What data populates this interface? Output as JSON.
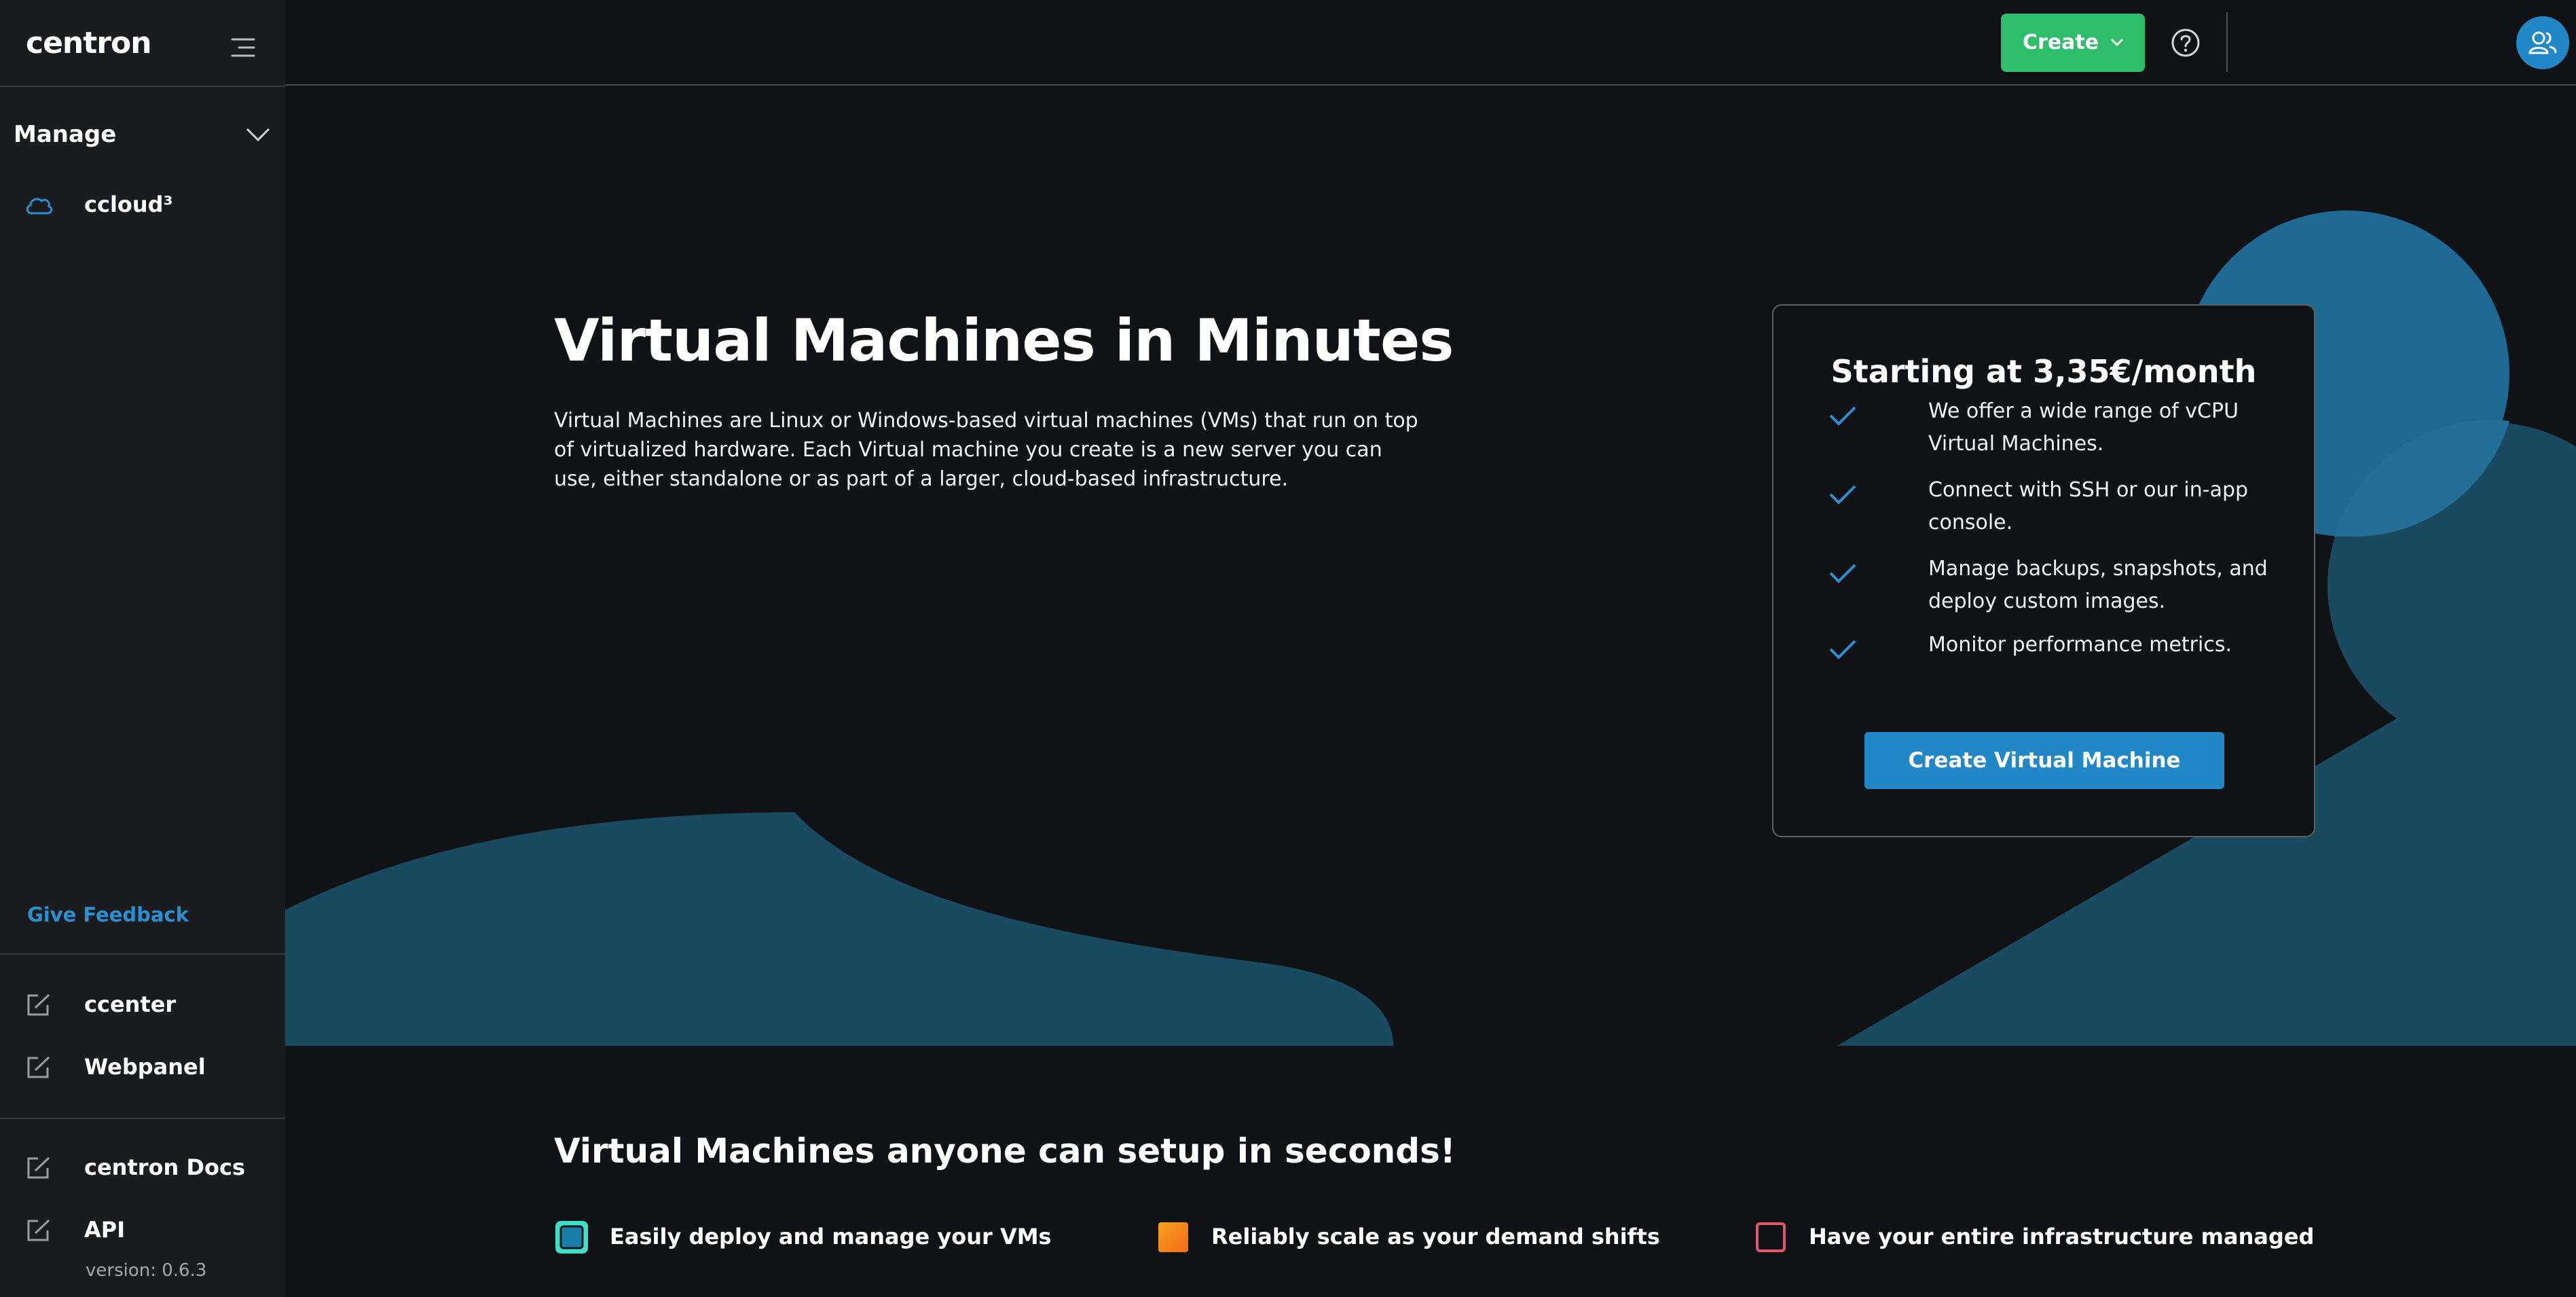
{
  "sidebar": {
    "logo": "centron",
    "section_label": "Manage",
    "items": [
      {
        "label": "ccloud³",
        "icon": "cloud-icon"
      }
    ],
    "feedback_label": "Give Feedback",
    "external_links": [
      {
        "label": "ccenter",
        "icon": "external-link-icon"
      },
      {
        "label": "Webpanel",
        "icon": "external-link-icon"
      }
    ],
    "docs_links": [
      {
        "label": "centron Docs",
        "icon": "external-link-icon"
      },
      {
        "label": "API",
        "icon": "external-link-icon"
      }
    ],
    "version": "version: 0.6.3"
  },
  "topbar": {
    "create_label": "Create",
    "help_icon": "help-circle-icon",
    "avatar_icon": "users-icon"
  },
  "hero": {
    "title": "Virtual Machines in Minutes",
    "description": "Virtual Machines are Linux or Windows-based virtual machines (VMs) that run on top of virtualized hardware. Each Virtual machine you create is a new server you can use, either standalone or as part of a larger, cloud-based infrastructure."
  },
  "card": {
    "title": "Starting at 3,35€/month",
    "features": [
      "We offer a wide range of vCPU Virtual Machines.",
      "Connect with SSH or our in-app console.",
      "Manage backups, snapshots, and deploy custom images.",
      "Monitor performance metrics."
    ],
    "button_label": "Create Virtual Machine"
  },
  "benefits": {
    "title": "Virtual Machines anyone can setup in seconds!",
    "items": [
      {
        "label": "Easily deploy and manage your VMs",
        "color": "#3ee0c8"
      },
      {
        "label": "Reliably scale as your demand shifts",
        "color": "#f78f1e"
      },
      {
        "label": "Have your entire infrastructure managed",
        "color": "#e0566e"
      }
    ]
  },
  "colors": {
    "accent_blue": "#2187c7",
    "accent_green": "#2fbd6c",
    "deco_blue": "#1a4a60",
    "background": "#111215",
    "sidebar": "#1b1c1f"
  }
}
